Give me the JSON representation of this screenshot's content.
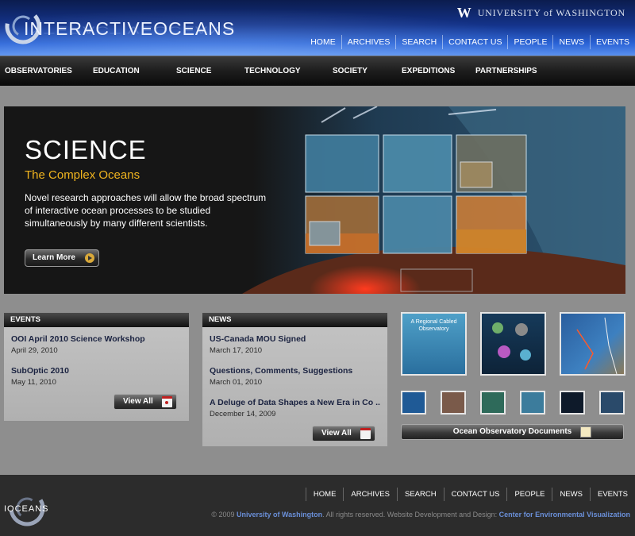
{
  "header": {
    "site_title": "INTERACTIVEOCEANS",
    "uw_mark": "W",
    "uw_label": "UNIVERSITY of WASHINGTON",
    "nav": [
      "HOME",
      "ARCHIVES",
      "SEARCH",
      "CONTACT US",
      "PEOPLE",
      "NEWS",
      "EVENTS"
    ]
  },
  "main_nav": [
    "OBSERVATORIES",
    "EDUCATION",
    "SCIENCE",
    "TECHNOLOGY",
    "SOCIETY",
    "EXPEDITIONS",
    "PARTNERSHIPS"
  ],
  "hero": {
    "title": "SCIENCE",
    "subtitle": "The Complex Oceans",
    "text": "Novel research approaches will allow the broad spectrum of interactive ocean processes to be studied simultaneously by many different scientists.",
    "button": "Learn More"
  },
  "events": {
    "heading": "EVENTS",
    "items": [
      {
        "title": "OOI April 2010 Science Workshop",
        "date": "April 29, 2010"
      },
      {
        "title": "SubOptic 2010",
        "date": "May 11, 2010"
      }
    ],
    "view_all": "View All"
  },
  "news": {
    "heading": "NEWS",
    "items": [
      {
        "title": "US-Canada MOU Signed",
        "date": "March 17, 2010"
      },
      {
        "title": "Questions, Comments, Suggestions",
        "date": "March 01, 2010"
      },
      {
        "title": "A Deluge of Data Shapes a New Era in Co ...",
        "date": "December 14, 2009"
      }
    ],
    "view_all": "View All"
  },
  "documents": {
    "thumb1_caption": "A Regional Cabled Observatory",
    "button": "Ocean Observatory Documents"
  },
  "footer": {
    "logo_text": "IOCEANS",
    "nav": [
      "HOME",
      "ARCHIVES",
      "SEARCH",
      "CONTACT US",
      "PEOPLE",
      "NEWS",
      "EVENTS"
    ],
    "copy_prefix": "© 2009 ",
    "copy_uw": "University of Washington",
    "copy_mid": ". All rights reserved. Website Development and Design: ",
    "copy_cev": "Center for Environmental Visualization"
  },
  "colors": {
    "header_blue": "#2a63d6",
    "accent_gold": "#f0b41f",
    "link_blue": "#6a8fd8"
  }
}
